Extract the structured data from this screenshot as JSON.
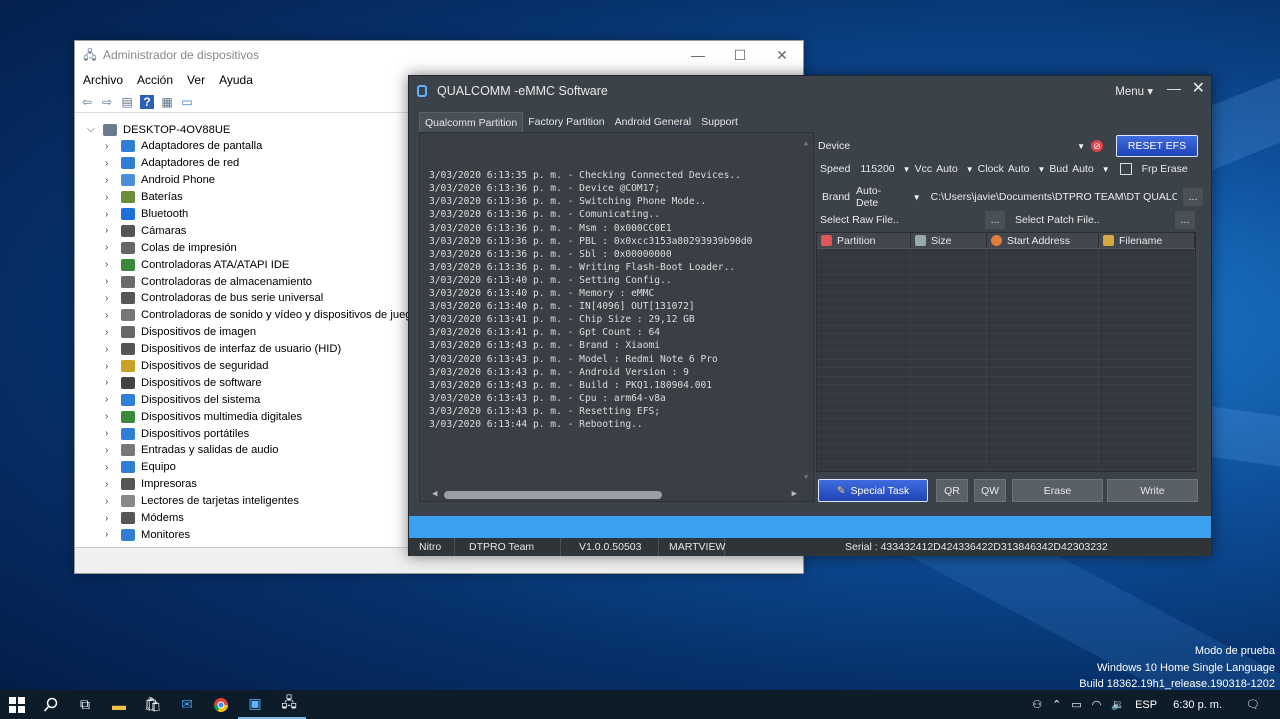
{
  "device_manager": {
    "title": "Administrador de dispositivos",
    "controls": [
      "—",
      "☐",
      "✕"
    ],
    "menu": [
      "Archivo",
      "Acción",
      "Ver",
      "Ayuda"
    ],
    "root": "DESKTOP-4OV88UE",
    "items": [
      {
        "label": "Adaptadores de pantalla",
        "color": "#2f7fd6"
      },
      {
        "label": "Adaptadores de red",
        "color": "#2f7fd6"
      },
      {
        "label": "Android Phone",
        "color": "#4a8fd8"
      },
      {
        "label": "Baterías",
        "color": "#6b8e3a"
      },
      {
        "label": "Bluetooth",
        "color": "#1a6fd8"
      },
      {
        "label": "Cámaras",
        "color": "#555555"
      },
      {
        "label": "Colas de impresión",
        "color": "#666666"
      },
      {
        "label": "Controladoras ATA/ATAPI IDE",
        "color": "#3b8a3b"
      },
      {
        "label": "Controladoras de almacenamiento",
        "color": "#6a6a6a"
      },
      {
        "label": "Controladoras de bus serie universal",
        "color": "#555555"
      },
      {
        "label": "Controladoras de sonido y vídeo y dispositivos de juego",
        "color": "#777777"
      },
      {
        "label": "Dispositivos de imagen",
        "color": "#666666"
      },
      {
        "label": "Dispositivos de interfaz de usuario (HID)",
        "color": "#555555"
      },
      {
        "label": "Dispositivos de seguridad",
        "color": "#c9a227"
      },
      {
        "label": "Dispositivos de software",
        "color": "#444444"
      },
      {
        "label": "Dispositivos del sistema",
        "color": "#2f7fd6"
      },
      {
        "label": "Dispositivos multimedia digitales",
        "color": "#3b8a3b"
      },
      {
        "label": "Dispositivos portátiles",
        "color": "#2f7fd6"
      },
      {
        "label": "Entradas y salidas de audio",
        "color": "#777777"
      },
      {
        "label": "Equipo",
        "color": "#2f7fd6"
      },
      {
        "label": "Impresoras",
        "color": "#555555"
      },
      {
        "label": "Lectores de tarjetas inteligentes",
        "color": "#888888"
      },
      {
        "label": "Módems",
        "color": "#555555"
      },
      {
        "label": "Monitores",
        "color": "#2f7fd6"
      }
    ]
  },
  "qualcomm": {
    "title": "QUALCOMM -eMMC Software",
    "menu_label": "Menu ▾",
    "tabs": [
      "Qualcomm Partition",
      "Factory Partition",
      "Android General",
      "Support"
    ],
    "log": [
      "3/03/2020 6:13:35 p. m. - Checking Connected Devices..",
      "3/03/2020 6:13:36 p. m. - Device @COM17;",
      "3/03/2020 6:13:36 p. m. - Switching Phone Mode..",
      "3/03/2020 6:13:36 p. m. - Comunicating..",
      "3/03/2020 6:13:36 p. m. - Msm : 0x000CC0E1",
      "3/03/2020 6:13:36 p. m. - PBL : 0x0xcc3153a80293939b90d0",
      "3/03/2020 6:13:36 p. m. - Sbl : 0x00000000",
      "3/03/2020 6:13:36 p. m. - Writing Flash-Boot Loader..",
      "3/03/2020 6:13:40 p. m. - Setting Config..",
      "3/03/2020 6:13:40 p. m. - Memory : eMMC",
      "3/03/2020 6:13:40 p. m. - IN[4096] OUT[131072]",
      "3/03/2020 6:13:41 p. m. - Chip Size : 29,12 GB",
      "3/03/2020 6:13:41 p. m. - Gpt Count : 64",
      "3/03/2020 6:13:43 p. m. - Brand : Xiaomi",
      "3/03/2020 6:13:43 p. m. - Model : Redmi Note 6 Pro",
      "3/03/2020 6:13:43 p. m. - Android Version : 9",
      "3/03/2020 6:13:43 p. m. - Build : PKQ1.180904.001",
      "3/03/2020 6:13:43 p. m. - Cpu : arm64-v8a",
      "3/03/2020 6:13:43 p. m. - Resetting EFS;",
      "3/03/2020 6:13:44 p. m. - Rebooting.."
    ],
    "device_label": "Device",
    "reset_efs": "RESET EFS",
    "speed_label": "Speed",
    "speed_value": "115200",
    "vcc_label": "Vcc",
    "vcc_value": "Auto",
    "clock_label": "Clock",
    "clock_value": "Auto",
    "bud_label": "Bud",
    "bud_value": "Auto",
    "frp_label": "Frp Erase",
    "brand_label": "Brand",
    "brand_value": "Auto-Dete",
    "path_value": "C:\\Users\\javie\\Documents\\DTPRO TEAM\\DT QUALC",
    "select_raw": "Select Raw File..",
    "select_patch": "Select Patch File..",
    "browse": "...",
    "columns": [
      "Partition",
      "Size",
      "Start Address",
      "Filename"
    ],
    "buttons": {
      "special": "Special Task",
      "qr": "QR",
      "qw": "QW",
      "erase": "Erase",
      "write": "Write"
    },
    "status": [
      "Nitro",
      "DTPRO Team",
      "V1.0.0.50503",
      "MARTVIEW",
      "Serial : 433432412D424336422D313846342D42303232"
    ]
  },
  "watermark": [
    "Modo de prueba",
    "Windows 10 Home Single Language",
    "Build 18362.19h1_release.190318-1202"
  ],
  "tray": {
    "lang": "ESP",
    "time": "6:30 p. m."
  }
}
